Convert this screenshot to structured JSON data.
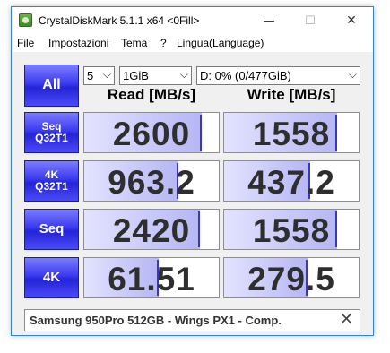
{
  "window": {
    "title": "CrystalDiskMark 5.1.1 x64 <0Fill>",
    "minimize_glyph": "—",
    "maximize_glyph": "☐",
    "close_glyph": "✕"
  },
  "menu": {
    "items": [
      "File",
      "Impostazioni",
      "Tema",
      "?",
      "Lingua(Language)"
    ]
  },
  "controls": {
    "all_label": "All",
    "test_count": "5",
    "test_size": "1GiB",
    "drive": "D: 0% (0/477GiB)",
    "chevron_glyph": "⌵"
  },
  "columns": {
    "read": "Read [MB/s]",
    "write": "Write [MB/s]"
  },
  "tests": [
    {
      "line1": "Seq",
      "line2": "Q32T1",
      "read": "2600",
      "write": "1558",
      "read_fill": 0.87,
      "write_fill": 0.84
    },
    {
      "line1": "4K",
      "line2": "Q32T1",
      "read": "963.2",
      "write": "437.2",
      "read_fill": 0.7,
      "write_fill": 0.64
    },
    {
      "line1": "Seq",
      "line2": "",
      "read": "2420",
      "write": "1558",
      "read_fill": 0.86,
      "write_fill": 0.84
    },
    {
      "line1": "4K",
      "line2": "",
      "read": "61.51",
      "write": "279.5",
      "read_fill": 0.55,
      "write_fill": 0.62
    }
  ],
  "comment": {
    "text": "Samsung 950Pro 512GB - Wings PX1 - Comp.",
    "clear_glyph": "✕"
  },
  "colors": {
    "accent": "#3a3af0",
    "bar_fill": "#b6b6f4",
    "bar_edge": "#3636c8"
  }
}
